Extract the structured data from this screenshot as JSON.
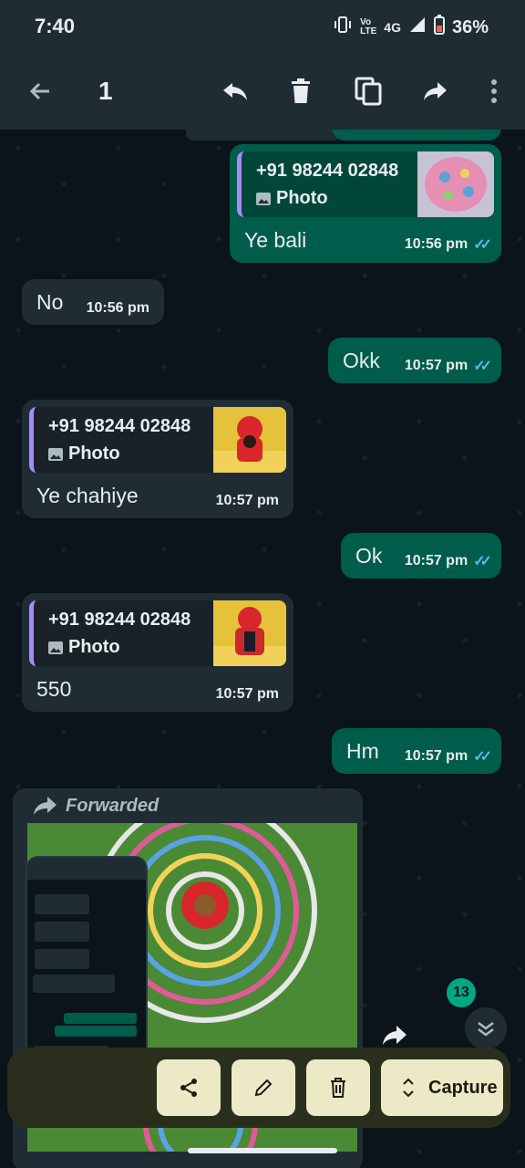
{
  "status": {
    "time": "7:40",
    "network": "4G",
    "battery": "36%"
  },
  "header": {
    "selected_count": "1"
  },
  "messages": {
    "m1": {
      "quote_name": "+91 98244 02848",
      "quote_type": "Photo",
      "text": "Ye bali",
      "time": "10:56 pm"
    },
    "m2": {
      "text": "No",
      "time": "10:56 pm"
    },
    "m3": {
      "text": "Okk",
      "time": "10:57 pm"
    },
    "m4": {
      "quote_name": "+91 98244 02848",
      "quote_type": "Photo",
      "text": "Ye chahiye",
      "time": "10:57 pm"
    },
    "m5": {
      "text": "Ok",
      "time": "10:57 pm"
    },
    "m6": {
      "quote_name": "+91 98244 02848",
      "quote_type": "Photo",
      "text": "550",
      "time": "10:57 pm"
    },
    "m7": {
      "text": "Hm",
      "time": "10:57 pm"
    },
    "m8": {
      "label": "Forwarded"
    }
  },
  "unread_badge": "13",
  "toolbar": {
    "capture_label": "Capture"
  },
  "colors": {
    "out_bubble": "#005c4b",
    "in_bubble": "#1f2c34",
    "tick_read": "#53bdeb",
    "quote_bar": "#a78bfa"
  }
}
